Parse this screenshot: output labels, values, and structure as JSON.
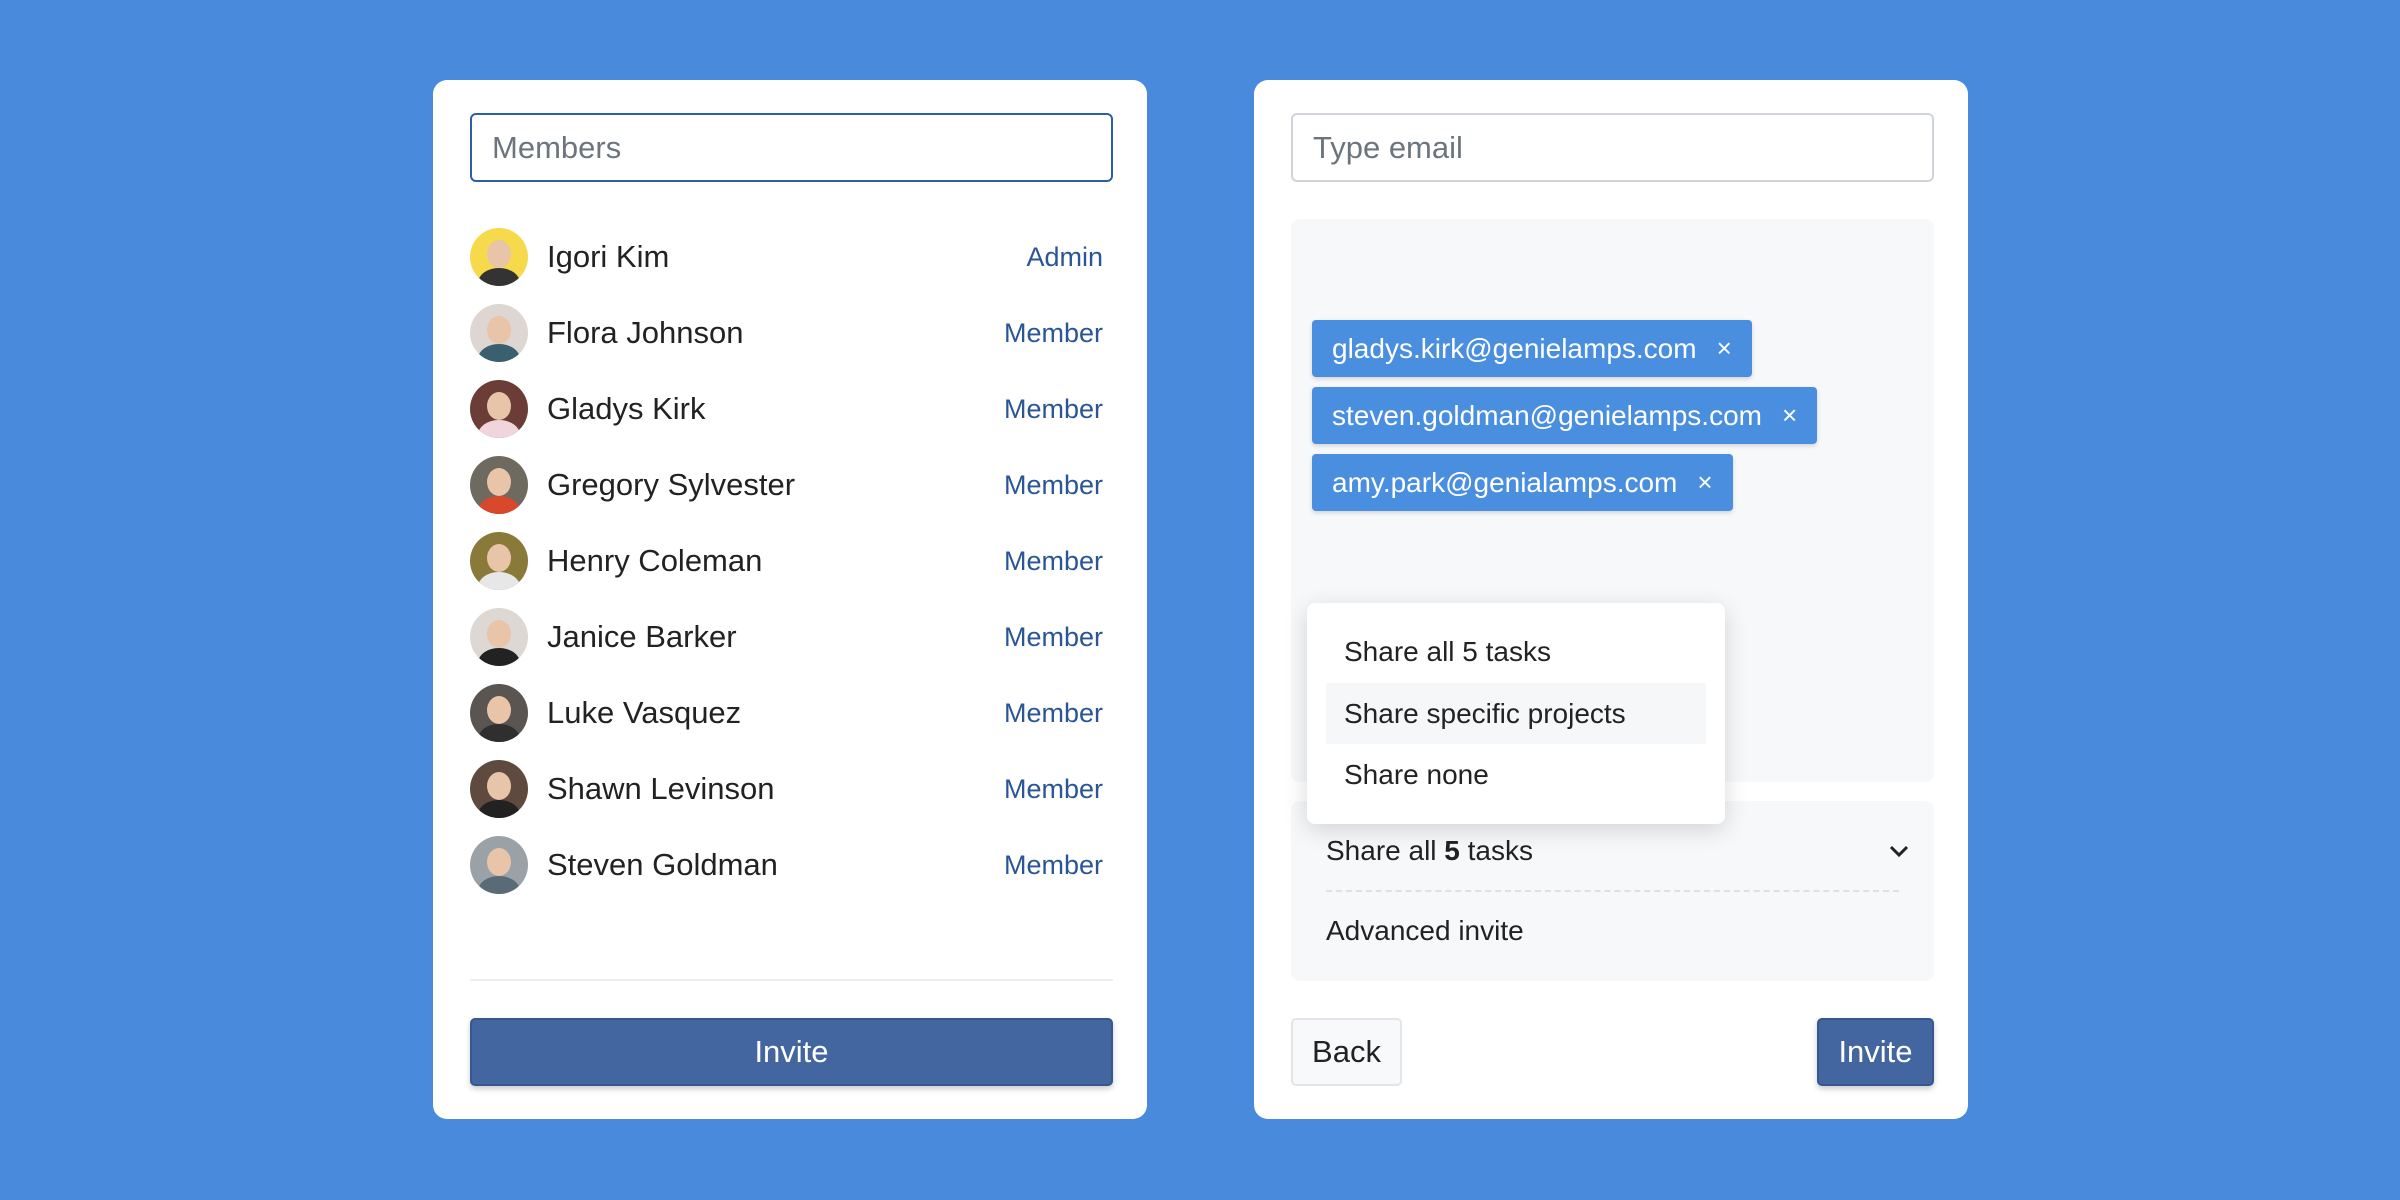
{
  "members_panel": {
    "search_placeholder": "Members",
    "members": [
      {
        "name": "Igori Kim",
        "role": "Admin",
        "bg": "#f7d94c",
        "shirt": "#333"
      },
      {
        "name": "Flora Johnson",
        "role": "Member",
        "bg": "#ddd6d2",
        "shirt": "#3a5f6e"
      },
      {
        "name": "Gladys Kirk",
        "role": "Member",
        "bg": "#6b3d36",
        "shirt": "#f1d5dc"
      },
      {
        "name": "Gregory Sylvester",
        "role": "Member",
        "bg": "#6e6a60",
        "shirt": "#d8482a"
      },
      {
        "name": "Henry Coleman",
        "role": "Member",
        "bg": "#8a7a3a",
        "shirt": "#e7e7e7"
      },
      {
        "name": "Janice Barker",
        "role": "Member",
        "bg": "#ddd8d4",
        "shirt": "#222"
      },
      {
        "name": "Luke Vasquez",
        "role": "Member",
        "bg": "#5a5550",
        "shirt": "#2f2f2f"
      },
      {
        "name": "Shawn Levinson",
        "role": "Member",
        "bg": "#5e4a3e",
        "shirt": "#222"
      },
      {
        "name": "Steven Goldman",
        "role": "Member",
        "bg": "#9aa2a8",
        "shirt": "#5a6b78"
      }
    ],
    "invite_label": "Invite"
  },
  "invite_panel": {
    "email_placeholder": "Type email",
    "emails": [
      "gladys.kirk@genielamps.com",
      "steven.goldman@genielamps.com",
      "amy.park@genialamps.com"
    ],
    "remove_icon": "×",
    "dropdown_options": [
      "Share all 5 tasks",
      "Share specific projects",
      "Share none"
    ],
    "highlighted_option": "Share specific projects",
    "share_select": {
      "prefix": "Share all ",
      "count": "5",
      "suffix": " tasks"
    },
    "advanced_invite": "Advanced invite",
    "back_label": "Back",
    "invite_label": "Invite"
  },
  "colors": {
    "background": "#4a8add",
    "primary": "#4366a0",
    "tag": "#4a8ee0",
    "role_link": "#2a5596"
  }
}
